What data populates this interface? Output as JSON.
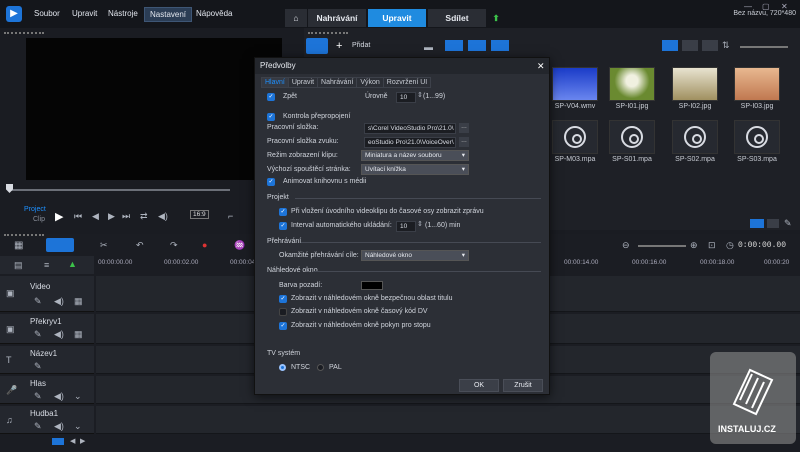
{
  "menu": {
    "items": [
      "Soubor",
      "Upravit",
      "Nástroje",
      "Nastavení",
      "Nápověda"
    ]
  },
  "tabs": {
    "home": "⌂",
    "capture": "Nahrávání",
    "edit": "Upravit",
    "share": "Sdílet",
    "upload": "⬆"
  },
  "project_title": "Bez názvu, 720*480",
  "preview": {
    "project_label": "Project",
    "clip_label": "Clip",
    "ratio": "16:9"
  },
  "library": {
    "add_label": "Přidat",
    "items": [
      {
        "name": "SP-V04.wmv",
        "kind": "video"
      },
      {
        "name": "SP-I01.jpg",
        "kind": "image"
      },
      {
        "name": "SP-I02.jpg",
        "kind": "image"
      },
      {
        "name": "SP-I03.jpg",
        "kind": "image"
      },
      {
        "name": "SP-M03.mpa",
        "kind": "audio"
      },
      {
        "name": "SP-S01.mpa",
        "kind": "audio"
      },
      {
        "name": "SP-S02.mpa",
        "kind": "audio"
      },
      {
        "name": "SP-S03.mpa",
        "kind": "audio"
      }
    ]
  },
  "timeline": {
    "timecode": "0:00:00.00",
    "ruler": [
      "00:00:00.00",
      "00:00:02.00",
      "00:00:04",
      "00:00:14.00",
      "00:00:16.00",
      "00:00:18.00",
      "00:00:20"
    ],
    "tracks": [
      "Video",
      "Překryv1",
      "Název1",
      "Hlas",
      "Hudba1"
    ]
  },
  "dialog": {
    "title": "Předvolby",
    "close": "✕",
    "tabs": [
      "Hlavní",
      "Upravit",
      "Nahrávání",
      "Výkon",
      "Rozvržení UI"
    ],
    "undo_label": "Zpět",
    "levels_label": "Úrovně",
    "levels_value": "10",
    "levels_range": "(1...99)",
    "relink_label": "Kontrola přepropojení",
    "workdir_label": "Pracovní složka:",
    "workdir_value": "s\\Corel VideoStudio Pro\\21.0\\",
    "audio_workdir_label": "Pracovní složka zvuku:",
    "audio_workdir_value": "eoStudio Pro\\21.0\\VoiceOver\\",
    "clip_display_label": "Režim zobrazení klipu:",
    "clip_display_value": "Miniatura a název souboru",
    "startup_label": "Výchozí spouštěcí stránka:",
    "startup_value": "Uvítací knížka",
    "animate_label": "Animovat knihovnu s médii",
    "section_project": "Projekt",
    "insert_msg_label": "Při vložení úvodního videoklipu do časové osy zobrazit zprávu",
    "autosave_label": "Interval automatického ukládání:",
    "autosave_value": "10",
    "autosave_range": "(1...60) min",
    "section_playback": "Přehrávání",
    "instant_label": "Okamžité přehrávání cíle:",
    "instant_value": "Náhledové okno",
    "section_preview": "Náhledové okno",
    "bg_label": "Barva pozadí:",
    "safe_label": "Zobrazit v náhledovém okně bezpečnou oblast titulu",
    "tc_label": "Zobrazit v náhledovém okně časový kód DV",
    "track_label": "Zobrazit v náhledovém okně pokyn pro stopu",
    "section_tv": "TV systém",
    "ntsc": "NTSC",
    "pal": "PAL",
    "ok": "OK",
    "cancel": "Zrušit"
  },
  "watermark": "INSTALUJ.CZ"
}
